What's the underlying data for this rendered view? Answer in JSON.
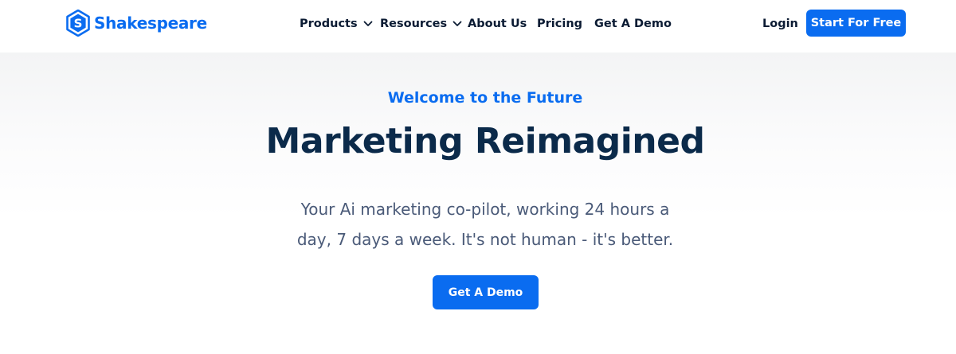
{
  "header": {
    "logo_text": "Shakespeare",
    "nav": [
      {
        "label": "Products",
        "has_dropdown": true
      },
      {
        "label": "Resources",
        "has_dropdown": true
      },
      {
        "label": "About Us",
        "has_dropdown": false
      },
      {
        "label": "Pricing",
        "has_dropdown": false
      },
      {
        "label": "Get A Demo",
        "has_dropdown": false
      }
    ],
    "login_label": "Login",
    "cta_label": "Start For Free"
  },
  "hero": {
    "eyebrow": "Welcome to the Future",
    "title": "Marketing Reimagined",
    "subtitle": "Your Ai marketing co-pilot, working 24 hours a day, 7 days a week. It's not human - it's better.",
    "cta_label": "Get A Demo"
  },
  "colors": {
    "brand_blue": "#0a6cf0",
    "heading_navy": "#0b2a4a",
    "nav_text": "#0b1b33",
    "body_text": "#4a5a78"
  },
  "icons": {
    "logo": "shakespeare-shield-s-icon",
    "dropdown": "chevron-down-icon"
  }
}
